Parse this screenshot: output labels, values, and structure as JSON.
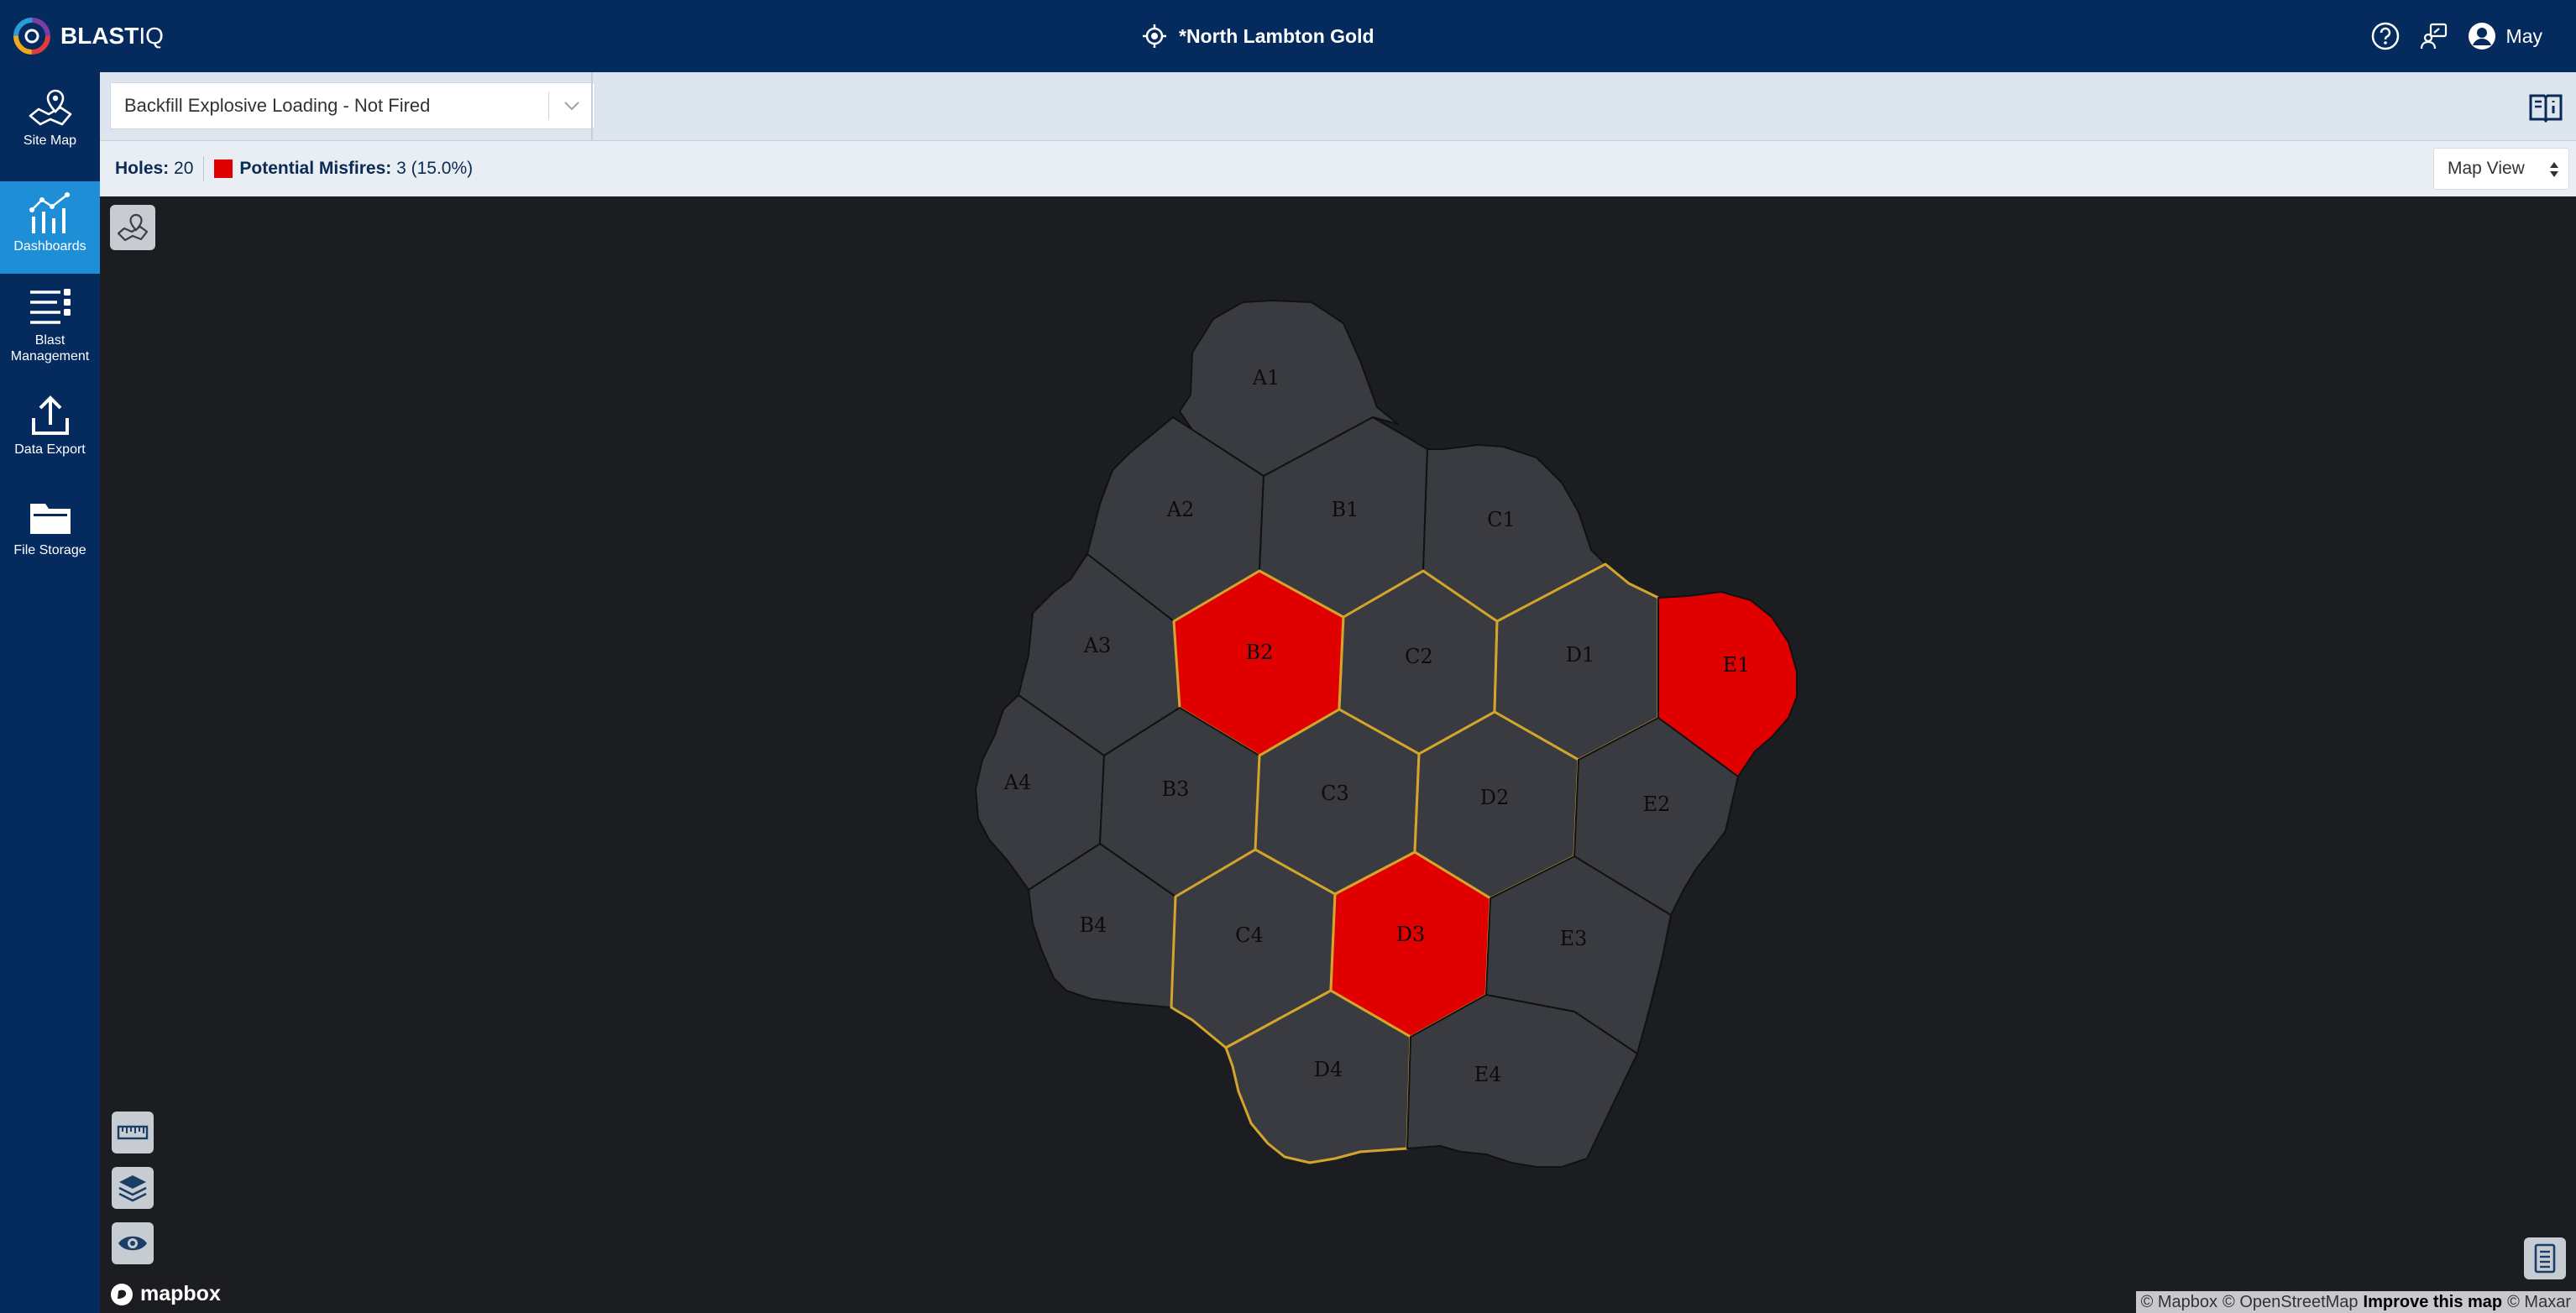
{
  "header": {
    "logo_main": "BLAST",
    "logo_suffix": "IQ",
    "site_title": "*North Lambton Gold",
    "user_name": "May"
  },
  "sidebar": {
    "items": [
      {
        "label": "Site Map",
        "icon": "site-map-icon"
      },
      {
        "label": "Dashboards",
        "icon": "dashboards-icon",
        "active": true
      },
      {
        "label": "Blast Management",
        "icon": "blast-management-icon"
      },
      {
        "label": "Data Export",
        "icon": "data-export-icon"
      },
      {
        "label": "File Storage",
        "icon": "file-storage-icon"
      }
    ]
  },
  "toolbar": {
    "dashboard_select": "Backfill Explosive Loading - Not Fired"
  },
  "stats": {
    "holes_label": "Holes:",
    "holes_value": "20",
    "misfires_label": "Potential Misfires:",
    "misfires_value": "3 (15.0%)",
    "view_select": "Map View"
  },
  "map": {
    "holes": [
      {
        "id": "A1",
        "status": "normal"
      },
      {
        "id": "A2",
        "status": "normal"
      },
      {
        "id": "A3",
        "status": "normal"
      },
      {
        "id": "A4",
        "status": "normal"
      },
      {
        "id": "B1",
        "status": "normal"
      },
      {
        "id": "B2",
        "status": "misfire"
      },
      {
        "id": "B3",
        "status": "normal"
      },
      {
        "id": "B4",
        "status": "normal"
      },
      {
        "id": "C1",
        "status": "normal"
      },
      {
        "id": "C2",
        "status": "normal"
      },
      {
        "id": "C3",
        "status": "normal"
      },
      {
        "id": "C4",
        "status": "normal"
      },
      {
        "id": "D1",
        "status": "normal"
      },
      {
        "id": "D2",
        "status": "normal"
      },
      {
        "id": "D3",
        "status": "misfire"
      },
      {
        "id": "D4",
        "status": "normal"
      },
      {
        "id": "E1",
        "status": "misfire"
      },
      {
        "id": "E2",
        "status": "normal"
      },
      {
        "id": "E3",
        "status": "normal"
      },
      {
        "id": "E4",
        "status": "normal"
      }
    ],
    "attribution": {
      "mapbox": "© Mapbox",
      "osm": "© OpenStreetMap",
      "improve": "Improve this map",
      "maxar": "© Maxar"
    },
    "mapbox_logo": "mapbox"
  },
  "colors": {
    "header_bg": "#042a5e",
    "active_nav": "#1e8fd6",
    "misfire": "#e00000",
    "cell": "#3a3b40",
    "highlight_outline": "#d4a52b"
  }
}
